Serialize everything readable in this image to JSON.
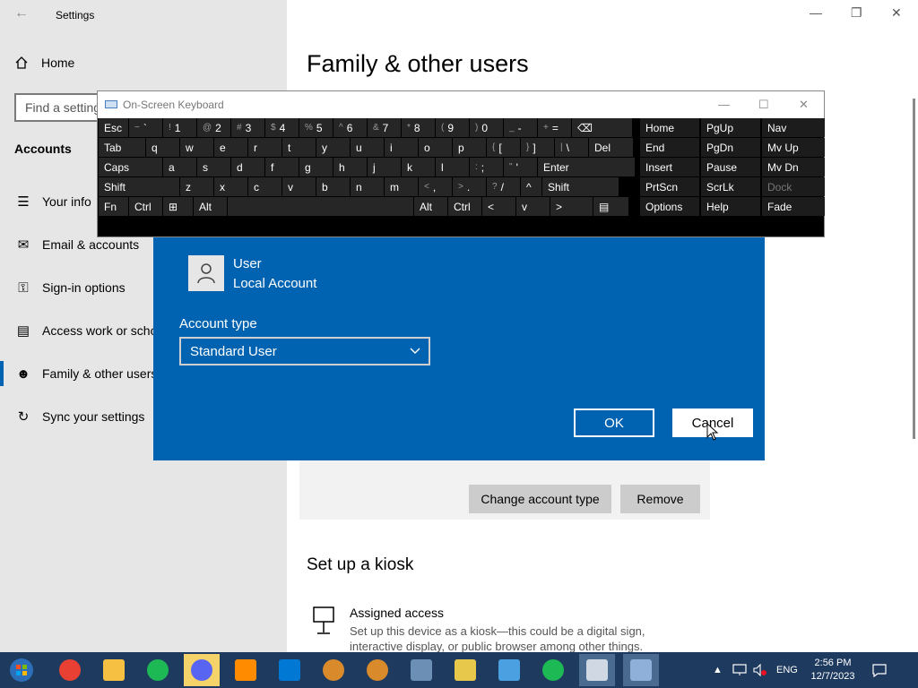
{
  "app": {
    "title": "Settings",
    "home": "Home",
    "search_placeholder": "Find a setting",
    "section": "Accounts",
    "nav": [
      {
        "label": "Your info",
        "icon": "person-list-icon"
      },
      {
        "label": "Email & accounts",
        "icon": "mail-icon"
      },
      {
        "label": "Sign-in options",
        "icon": "key-icon"
      },
      {
        "label": "Access work or school",
        "icon": "briefcase-icon"
      },
      {
        "label": "Family & other users",
        "icon": "family-icon"
      },
      {
        "label": "Sync your settings",
        "icon": "sync-icon"
      }
    ],
    "page_title": "Family & other users",
    "change_account_type": "Change account type",
    "remove": "Remove",
    "kiosk_title": "Set up a kiosk",
    "kiosk_head": "Assigned access",
    "kiosk_desc": "Set up this device as a kiosk—this could be a digital sign, interactive display, or public browser among other things."
  },
  "dialog": {
    "user_name": "User",
    "user_type": "Local Account",
    "account_type_label": "Account type",
    "account_type_value": "Standard User",
    "ok": "OK",
    "cancel": "Cancel"
  },
  "osk": {
    "title": "On-Screen Keyboard",
    "row1": [
      {
        "t": "Esc"
      },
      {
        "s": "~",
        "t": "`"
      },
      {
        "s": "!",
        "t": "1"
      },
      {
        "s": "@",
        "t": "2"
      },
      {
        "s": "#",
        "t": "3"
      },
      {
        "s": "$",
        "t": "4"
      },
      {
        "s": "%",
        "t": "5"
      },
      {
        "s": "^",
        "t": "6"
      },
      {
        "s": "&",
        "t": "7"
      },
      {
        "s": "*",
        "t": "8"
      },
      {
        "s": "(",
        "t": "9"
      },
      {
        "s": ")",
        "t": "0"
      },
      {
        "s": "_",
        "t": "-"
      },
      {
        "s": "+",
        "t": "="
      },
      {
        "t": "⌫"
      }
    ],
    "row2": [
      {
        "t": "Tab"
      },
      {
        "t": "q"
      },
      {
        "t": "w"
      },
      {
        "t": "e"
      },
      {
        "t": "r"
      },
      {
        "t": "t"
      },
      {
        "t": "y"
      },
      {
        "t": "u"
      },
      {
        "t": "i"
      },
      {
        "t": "o"
      },
      {
        "t": "p"
      },
      {
        "s": "{",
        "t": "["
      },
      {
        "s": "}",
        "t": "]"
      },
      {
        "s": "|",
        "t": "\\"
      },
      {
        "t": "Del"
      }
    ],
    "row3": [
      {
        "t": "Caps"
      },
      {
        "t": "a"
      },
      {
        "t": "s"
      },
      {
        "t": "d"
      },
      {
        "t": "f"
      },
      {
        "t": "g"
      },
      {
        "t": "h"
      },
      {
        "t": "j"
      },
      {
        "t": "k"
      },
      {
        "t": "l"
      },
      {
        "s": ":",
        "t": ";"
      },
      {
        "s": "\"",
        "t": "'"
      },
      {
        "t": "Enter"
      }
    ],
    "row4": [
      {
        "t": "Shift"
      },
      {
        "t": "z"
      },
      {
        "t": "x"
      },
      {
        "t": "c"
      },
      {
        "t": "v"
      },
      {
        "t": "b"
      },
      {
        "t": "n"
      },
      {
        "t": "m"
      },
      {
        "s": "<",
        "t": ","
      },
      {
        "s": ">",
        "t": "."
      },
      {
        "s": "?",
        "t": "/"
      },
      {
        "t": "^"
      },
      {
        "t": "Shift"
      }
    ],
    "row5": [
      {
        "t": "Fn"
      },
      {
        "t": "Ctrl"
      },
      {
        "t": "⊞"
      },
      {
        "t": "Alt"
      },
      {
        "t": ""
      },
      {
        "t": "Alt"
      },
      {
        "t": "Ctrl"
      },
      {
        "t": "<"
      },
      {
        "t": "v"
      },
      {
        "t": ">"
      },
      {
        "t": "▤"
      }
    ],
    "nav1": [
      "Home",
      "End",
      "Insert",
      "PrtScn",
      "Options"
    ],
    "nav2": [
      "PgUp",
      "PgDn",
      "Pause",
      "ScrLk",
      "Help"
    ],
    "nav3": [
      "Nav",
      "Mv Up",
      "Mv Dn",
      "Dock",
      "Fade"
    ]
  },
  "taskbar": {
    "lang": "ENG",
    "time": "2:56 PM",
    "date": "12/7/2023",
    "apps": [
      "chrome-icon",
      "file-explorer-icon",
      "spotify-icon",
      "discord-icon",
      "paint-icon",
      "remote-desktop-icon",
      "media-player-icon",
      "media-player-icon",
      "calculator-icon",
      "folder-icon",
      "control-panel-icon",
      "spotify-icon",
      "settings-icon",
      "on-screen-keyboard-icon"
    ]
  }
}
